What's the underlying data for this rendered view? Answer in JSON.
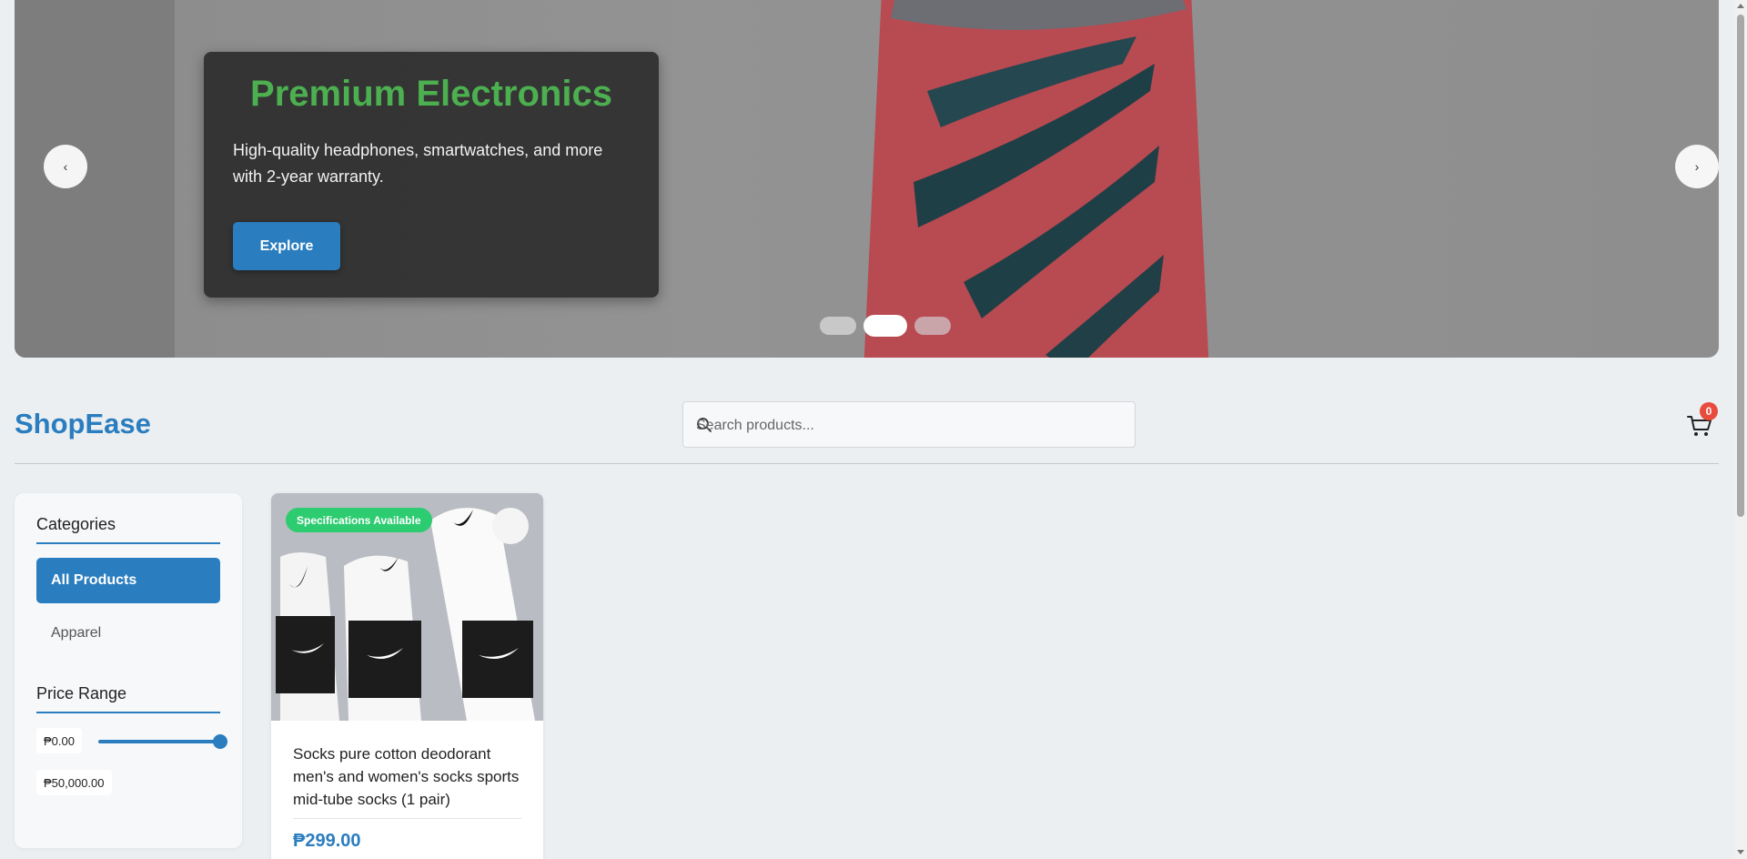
{
  "hero": {
    "title": "Premium Electronics",
    "description": "High-quality headphones, smartwatches, and more with 2-year warranty.",
    "button_label": "Explore",
    "prev_arrow": "‹",
    "next_arrow": "›",
    "slides_count": 3,
    "active_slide": 2
  },
  "header": {
    "brand": "ShopEase",
    "search_placeholder": "Search products...",
    "cart_count": "0"
  },
  "sidebar": {
    "categories_heading": "Categories",
    "categories": [
      {
        "label": "All Products",
        "active": true
      },
      {
        "label": "Apparel",
        "active": false
      }
    ],
    "price_heading": "Price Range",
    "price_min": "₱0.00",
    "price_max": "₱50,000.00",
    "slider_value_fraction": 1.0
  },
  "products": [
    {
      "badge": "Specifications Available",
      "title": "Socks pure cotton deodorant men's and women's socks sports mid-tube socks (1 pair)",
      "price": "₱299.00"
    }
  ],
  "colors": {
    "accent": "#2a7dbf",
    "hero_title": "#4caf50",
    "badge_green": "#2ecc71",
    "cart_badge": "#e74c3c"
  },
  "icons": {
    "search": "search-icon",
    "cart": "cart-icon",
    "wishlist": "heart-icon"
  }
}
